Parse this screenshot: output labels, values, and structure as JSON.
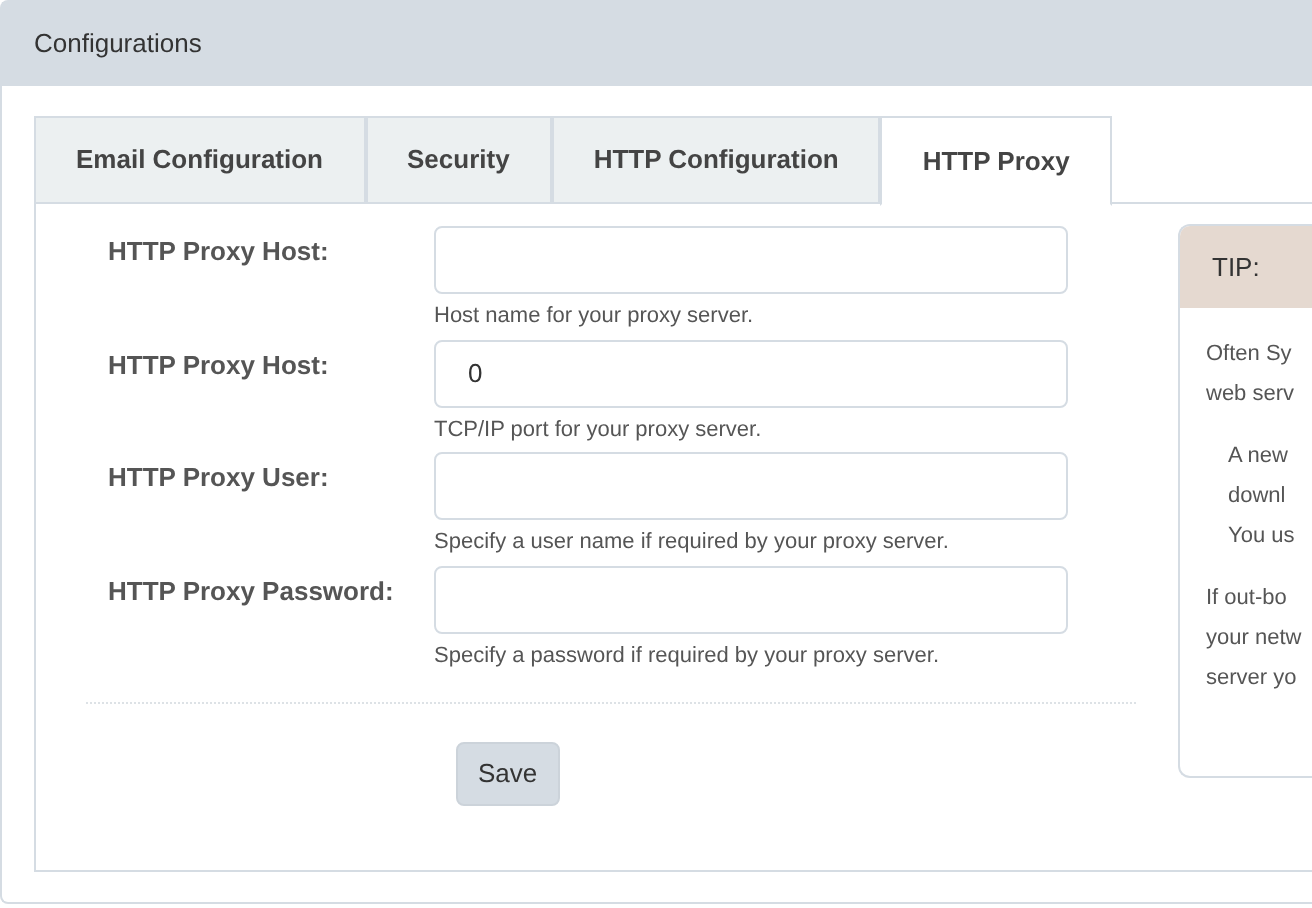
{
  "header": {
    "title": "Configurations"
  },
  "tabs": [
    {
      "label": "Email Configuration",
      "selected": false
    },
    {
      "label": "Security",
      "selected": false
    },
    {
      "label": "HTTP Configuration",
      "selected": false
    },
    {
      "label": "HTTP Proxy",
      "selected": true
    }
  ],
  "fields": [
    {
      "label": "HTTP Proxy Host:",
      "help": "Host name for your proxy server."
    },
    {
      "label": "HTTP Proxy Host:",
      "value": "0",
      "help": "TCP/IP port for your proxy server."
    },
    {
      "label": "HTTP Proxy User:",
      "help": "Specify a user name if required by your proxy server."
    },
    {
      "label": "HTTP Proxy Password:",
      "help": "Specify a password if required by your proxy server."
    }
  ],
  "save_button": "Save",
  "tip": {
    "title": "TIP:",
    "paragraphs": [
      {
        "indented": false,
        "lines": [
          "Often Sy",
          "web serv"
        ]
      },
      {
        "indented": true,
        "lines": [
          "A new",
          "downl",
          "You us"
        ]
      },
      {
        "indented": false,
        "lines": [
          "If out-bo",
          "your netw",
          "server yo"
        ]
      }
    ]
  }
}
